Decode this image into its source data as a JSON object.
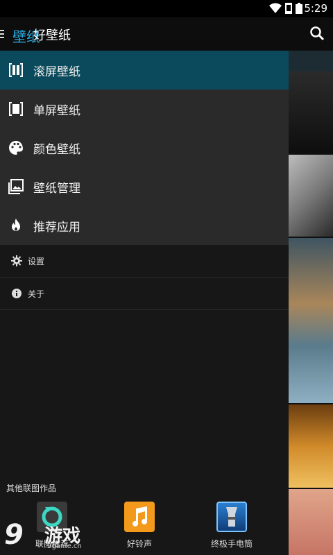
{
  "status_bar": {
    "time": "5:29",
    "wifi_icon": "wifi-icon",
    "sim_icon": "sim-icon",
    "battery_icon": "battery-icon"
  },
  "action_bar": {
    "logo_text": "壁纸",
    "title": "好壁纸",
    "menu_icon": "menu-icon",
    "search_icon": "search-icon"
  },
  "drawer": {
    "items": [
      {
        "label": "滚屏壁纸",
        "icon": "scroll-wallpaper-icon",
        "active": true
      },
      {
        "label": "单屏壁纸",
        "icon": "single-wallpaper-icon",
        "active": false
      },
      {
        "label": "颜色壁纸",
        "icon": "palette-icon",
        "active": false
      },
      {
        "label": "壁纸管理",
        "icon": "image-manage-icon",
        "active": false
      },
      {
        "label": "推荐应用",
        "icon": "flame-icon",
        "active": false
      }
    ],
    "secondary": [
      {
        "label": "设置",
        "icon": "gear-icon"
      },
      {
        "label": "关于",
        "icon": "info-icon"
      }
    ]
  },
  "other_apps": {
    "title": "其他联图作品",
    "apps": [
      {
        "label": "联图推荐",
        "icon": "refresh-app-icon"
      },
      {
        "label": "好铃声",
        "icon": "music-note-icon"
      },
      {
        "label": "终极手电筒",
        "icon": "flashlight-icon"
      }
    ]
  },
  "watermark": {
    "number": "9",
    "text": "游戏",
    "url": "9game.cn"
  },
  "colors": {
    "active": "#0b4a5c",
    "accent": "#2aa9e0",
    "drawer_primary_bg": "#2a2a2a"
  }
}
